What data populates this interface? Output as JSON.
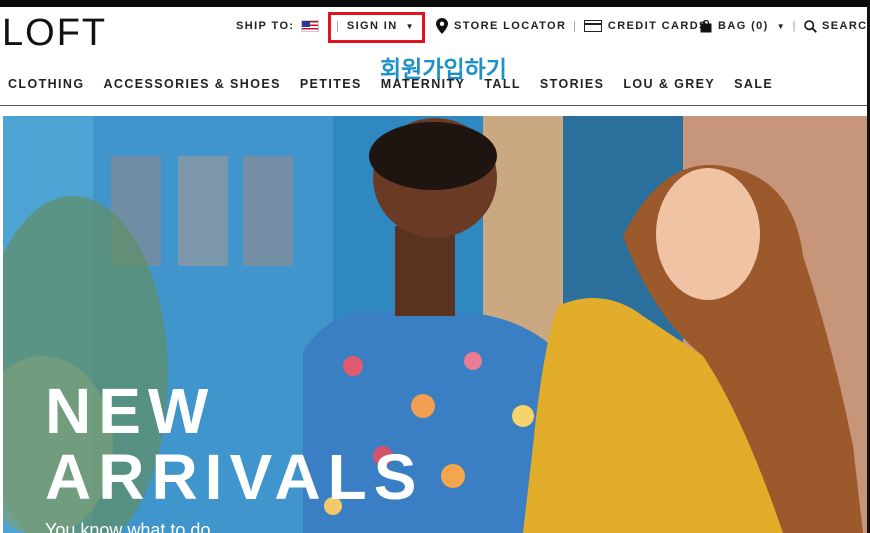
{
  "brand": {
    "logo_text": "LOFT"
  },
  "utility": {
    "ship_to_label": "SHIP TO:",
    "sign_in_label": "SIGN IN",
    "store_locator_label": "STORE LOCATOR",
    "credit_cards_label": "CREDIT CARDS",
    "bag_label": "BAG (0)",
    "search_label": "SEARC"
  },
  "annotation": {
    "text": "회원가입하기",
    "color": "#1e90c8",
    "highlight_color": "#e0141e"
  },
  "nav": {
    "items": [
      {
        "label": "CLOTHING"
      },
      {
        "label": "ACCESSORIES & SHOES"
      },
      {
        "label": "PETITES"
      },
      {
        "label": "MATERNITY"
      },
      {
        "label": "TALL"
      },
      {
        "label": "STORIES"
      },
      {
        "label": "LOU & GREY"
      },
      {
        "label": "SALE"
      }
    ]
  },
  "hero": {
    "title_line1": "NEW",
    "title_line2": "ARRIVALS",
    "subtitle": "You know what to do"
  }
}
